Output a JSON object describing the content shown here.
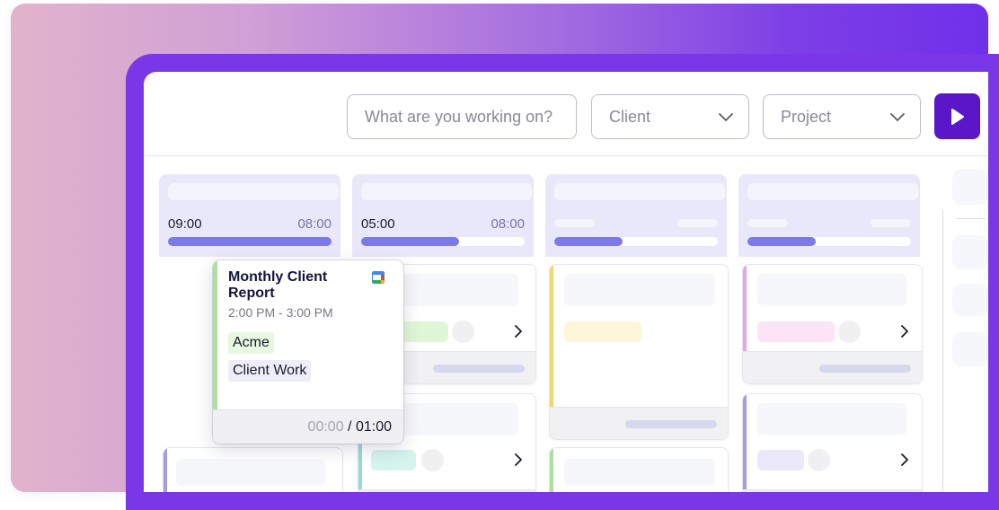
{
  "toolbar": {
    "search_placeholder": "What are you working on?",
    "client_label": "Client",
    "project_label": "Project",
    "icons": {
      "dropdown": "chevron-down-icon",
      "start": "play-icon"
    }
  },
  "columns": [
    {
      "time": "09:00",
      "target": "08:00",
      "progress": 1.0
    },
    {
      "time": "05:00",
      "target": "08:00",
      "progress": 0.6
    },
    {
      "time": "",
      "target": "",
      "progress": 0.42
    },
    {
      "time": "",
      "target": "",
      "progress": 0.42
    }
  ],
  "event": {
    "title": "Monthly Client Report",
    "time_range": "2:00 PM - 3:00 PM",
    "tags": [
      "Acme",
      "Client Work"
    ],
    "elapsed": "00:00",
    "separator": "/",
    "duration": "01:00",
    "icon": "google-calendar-icon",
    "accent_color": "#a9e29c"
  },
  "colors": {
    "primary": "#5a17c9",
    "progress_fill": "#7c7aea",
    "column_header": "#e9e8fb",
    "stripe_yellow": "#f2d66a",
    "stripe_pink": "#e7a6e2",
    "stripe_purple": "#a99be3",
    "stripe_teal": "#8fdfd0"
  }
}
